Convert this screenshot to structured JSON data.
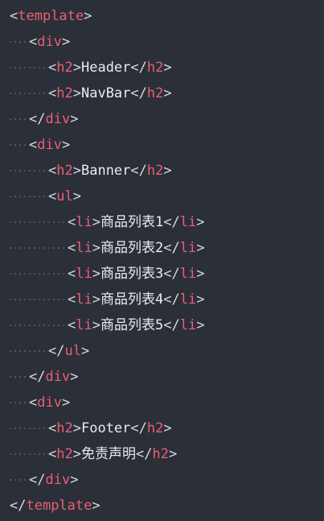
{
  "editor": {
    "theme": {
      "background": "#2b2f38",
      "tag_color": "#ea5f74",
      "bracket_color": "#d5d9e0",
      "text_color": "#e8ebf0",
      "guide_color": "#596170"
    },
    "lines": [
      {
        "indent": 0,
        "parts": [
          {
            "type": "bracket",
            "text": "<"
          },
          {
            "type": "tag",
            "text": "template"
          },
          {
            "type": "bracket",
            "text": ">"
          }
        ]
      },
      {
        "indent": 1,
        "parts": [
          {
            "type": "bracket",
            "text": "<"
          },
          {
            "type": "tag",
            "text": "div"
          },
          {
            "type": "bracket",
            "text": ">"
          }
        ]
      },
      {
        "indent": 2,
        "parts": [
          {
            "type": "bracket",
            "text": "<"
          },
          {
            "type": "tag",
            "text": "h2"
          },
          {
            "type": "bracket",
            "text": ">"
          },
          {
            "type": "text",
            "text": "Header"
          },
          {
            "type": "bracket",
            "text": "</"
          },
          {
            "type": "tag",
            "text": "h2"
          },
          {
            "type": "bracket",
            "text": ">"
          }
        ]
      },
      {
        "indent": 2,
        "parts": [
          {
            "type": "bracket",
            "text": "<"
          },
          {
            "type": "tag",
            "text": "h2"
          },
          {
            "type": "bracket",
            "text": ">"
          },
          {
            "type": "text",
            "text": "NavBar"
          },
          {
            "type": "bracket",
            "text": "</"
          },
          {
            "type": "tag",
            "text": "h2"
          },
          {
            "type": "bracket",
            "text": ">"
          }
        ]
      },
      {
        "indent": 1,
        "parts": [
          {
            "type": "bracket",
            "text": "</"
          },
          {
            "type": "tag",
            "text": "div"
          },
          {
            "type": "bracket",
            "text": ">"
          }
        ]
      },
      {
        "indent": 1,
        "parts": [
          {
            "type": "bracket",
            "text": "<"
          },
          {
            "type": "tag",
            "text": "div"
          },
          {
            "type": "bracket",
            "text": ">"
          }
        ]
      },
      {
        "indent": 2,
        "parts": [
          {
            "type": "bracket",
            "text": "<"
          },
          {
            "type": "tag",
            "text": "h2"
          },
          {
            "type": "bracket",
            "text": ">"
          },
          {
            "type": "text",
            "text": "Banner"
          },
          {
            "type": "bracket",
            "text": "</"
          },
          {
            "type": "tag",
            "text": "h2"
          },
          {
            "type": "bracket",
            "text": ">"
          }
        ]
      },
      {
        "indent": 2,
        "parts": [
          {
            "type": "bracket",
            "text": "<"
          },
          {
            "type": "tag",
            "text": "ul"
          },
          {
            "type": "bracket",
            "text": ">"
          }
        ]
      },
      {
        "indent": 3,
        "parts": [
          {
            "type": "bracket",
            "text": "<"
          },
          {
            "type": "tag",
            "text": "li"
          },
          {
            "type": "bracket",
            "text": ">"
          },
          {
            "type": "text",
            "text": "商品列表1"
          },
          {
            "type": "bracket",
            "text": "</"
          },
          {
            "type": "tag",
            "text": "li"
          },
          {
            "type": "bracket",
            "text": ">"
          }
        ]
      },
      {
        "indent": 3,
        "parts": [
          {
            "type": "bracket",
            "text": "<"
          },
          {
            "type": "tag",
            "text": "li"
          },
          {
            "type": "bracket",
            "text": ">"
          },
          {
            "type": "text",
            "text": "商品列表2"
          },
          {
            "type": "bracket",
            "text": "</"
          },
          {
            "type": "tag",
            "text": "li"
          },
          {
            "type": "bracket",
            "text": ">"
          }
        ]
      },
      {
        "indent": 3,
        "parts": [
          {
            "type": "bracket",
            "text": "<"
          },
          {
            "type": "tag",
            "text": "li"
          },
          {
            "type": "bracket",
            "text": ">"
          },
          {
            "type": "text",
            "text": "商品列表3"
          },
          {
            "type": "bracket",
            "text": "</"
          },
          {
            "type": "tag",
            "text": "li"
          },
          {
            "type": "bracket",
            "text": ">"
          }
        ]
      },
      {
        "indent": 3,
        "parts": [
          {
            "type": "bracket",
            "text": "<"
          },
          {
            "type": "tag",
            "text": "li"
          },
          {
            "type": "bracket",
            "text": ">"
          },
          {
            "type": "text",
            "text": "商品列表4"
          },
          {
            "type": "bracket",
            "text": "</"
          },
          {
            "type": "tag",
            "text": "li"
          },
          {
            "type": "bracket",
            "text": ">"
          }
        ]
      },
      {
        "indent": 3,
        "parts": [
          {
            "type": "bracket",
            "text": "<"
          },
          {
            "type": "tag",
            "text": "li"
          },
          {
            "type": "bracket",
            "text": ">"
          },
          {
            "type": "text",
            "text": "商品列表5"
          },
          {
            "type": "bracket",
            "text": "</"
          },
          {
            "type": "tag",
            "text": "li"
          },
          {
            "type": "bracket",
            "text": ">"
          }
        ]
      },
      {
        "indent": 2,
        "parts": [
          {
            "type": "bracket",
            "text": "</"
          },
          {
            "type": "tag",
            "text": "ul"
          },
          {
            "type": "bracket",
            "text": ">"
          }
        ]
      },
      {
        "indent": 1,
        "parts": [
          {
            "type": "bracket",
            "text": "</"
          },
          {
            "type": "tag",
            "text": "div"
          },
          {
            "type": "bracket",
            "text": ">"
          }
        ]
      },
      {
        "indent": 1,
        "parts": [
          {
            "type": "bracket",
            "text": "<"
          },
          {
            "type": "tag",
            "text": "div"
          },
          {
            "type": "bracket",
            "text": ">"
          }
        ]
      },
      {
        "indent": 2,
        "parts": [
          {
            "type": "bracket",
            "text": "<"
          },
          {
            "type": "tag",
            "text": "h2"
          },
          {
            "type": "bracket",
            "text": ">"
          },
          {
            "type": "text",
            "text": "Footer"
          },
          {
            "type": "bracket",
            "text": "</"
          },
          {
            "type": "tag",
            "text": "h2"
          },
          {
            "type": "bracket",
            "text": ">"
          }
        ]
      },
      {
        "indent": 2,
        "parts": [
          {
            "type": "bracket",
            "text": "<"
          },
          {
            "type": "tag",
            "text": "h2"
          },
          {
            "type": "bracket",
            "text": ">"
          },
          {
            "type": "text",
            "text": "免责声明"
          },
          {
            "type": "bracket",
            "text": "</"
          },
          {
            "type": "tag",
            "text": "h2"
          },
          {
            "type": "bracket",
            "text": ">"
          }
        ]
      },
      {
        "indent": 1,
        "parts": [
          {
            "type": "bracket",
            "text": "</"
          },
          {
            "type": "tag",
            "text": "div"
          },
          {
            "type": "bracket",
            "text": ">"
          }
        ]
      },
      {
        "indent": 0,
        "parts": [
          {
            "type": "bracket",
            "text": "</"
          },
          {
            "type": "tag",
            "text": "template"
          },
          {
            "type": "bracket",
            "text": ">"
          }
        ]
      }
    ]
  }
}
